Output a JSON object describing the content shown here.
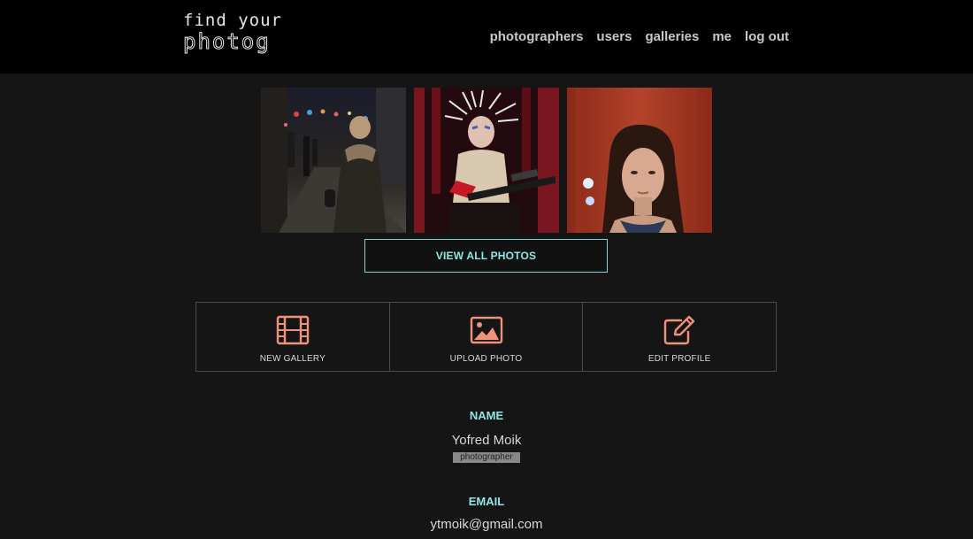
{
  "header": {
    "logo_line1": "find your",
    "logo_line2": "photog",
    "nav": [
      {
        "label": "photographers"
      },
      {
        "label": "users"
      },
      {
        "label": "galleries"
      },
      {
        "label": "me"
      },
      {
        "label": "log out"
      }
    ]
  },
  "gallery": {
    "photos": [
      "city-street-night",
      "performer-guitar",
      "woman-portrait"
    ],
    "view_all_label": "VIEW ALL PHOTOS"
  },
  "actions": [
    {
      "label": "NEW GALLERY",
      "icon": "film-icon"
    },
    {
      "label": "UPLOAD PHOTO",
      "icon": "image-icon"
    },
    {
      "label": "EDIT PROFILE",
      "icon": "edit-icon"
    }
  ],
  "profile": {
    "name_label": "NAME",
    "name": "Yofred Moik",
    "role": "photographer",
    "email_label": "EMAIL",
    "email": "ytmoik@gmail.com"
  },
  "colors": {
    "accent": "#8ee6e6",
    "icon": "#f0917a",
    "background": "#151515",
    "header": "#000000"
  }
}
